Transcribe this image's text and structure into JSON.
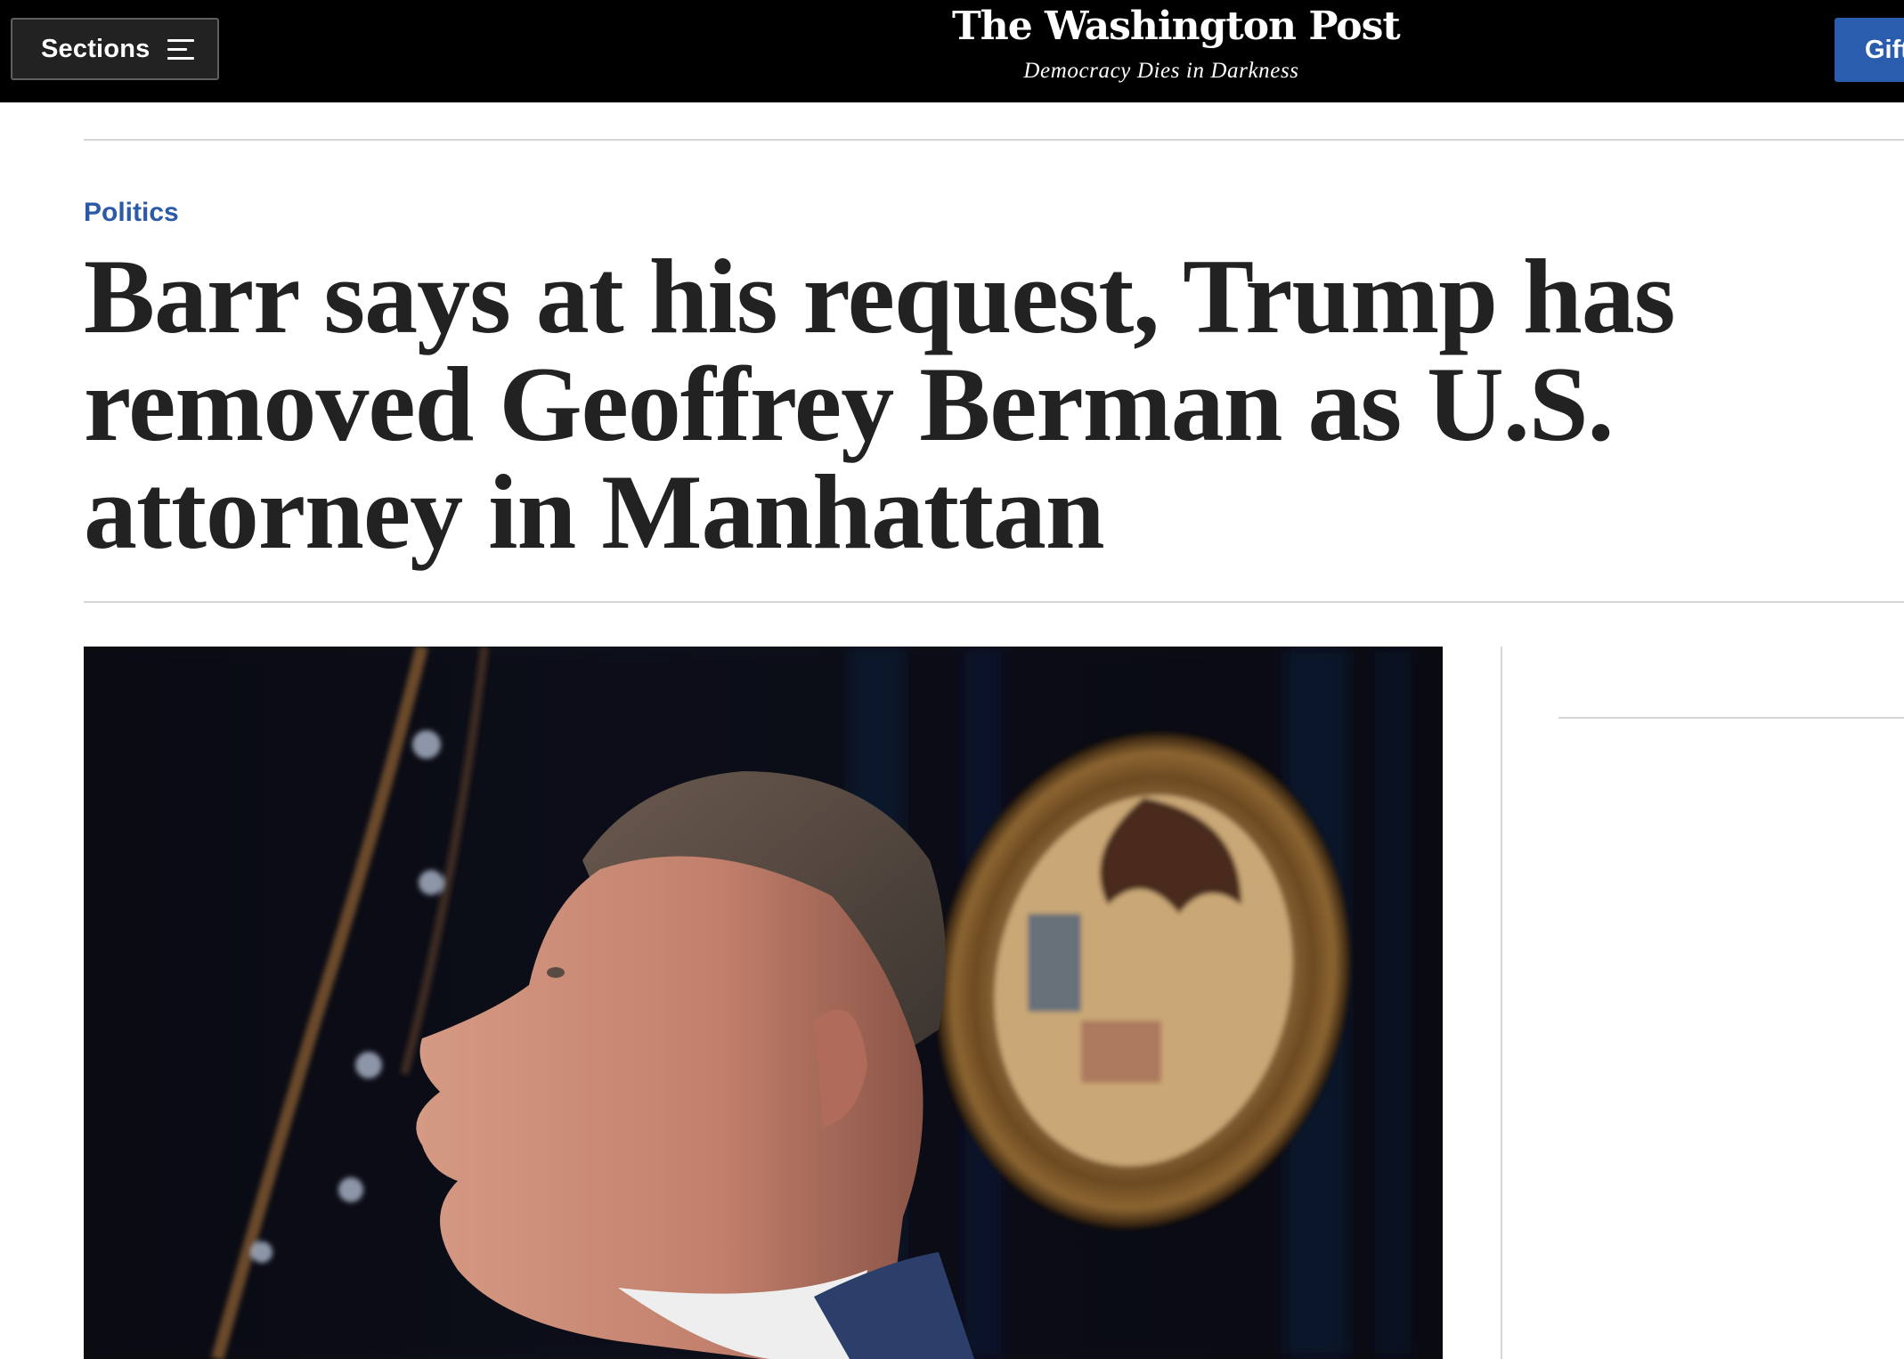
{
  "topbar": {
    "sections_label": "Sections",
    "logo": "The Washington Post",
    "tagline": "Democracy Dies in Darkness",
    "gift_label": "Gift"
  },
  "article": {
    "kicker": "Politics",
    "headline": "Barr says at his request, Trump has removed Geoffrey Berman as U.S. attorney in Manhattan"
  },
  "colors": {
    "topbar_bg": "#000000",
    "kicker": "#2a5aa8",
    "gift_button": "#2b5dae",
    "headline": "#222222"
  },
  "icons": {
    "sections": "menu-icon"
  }
}
